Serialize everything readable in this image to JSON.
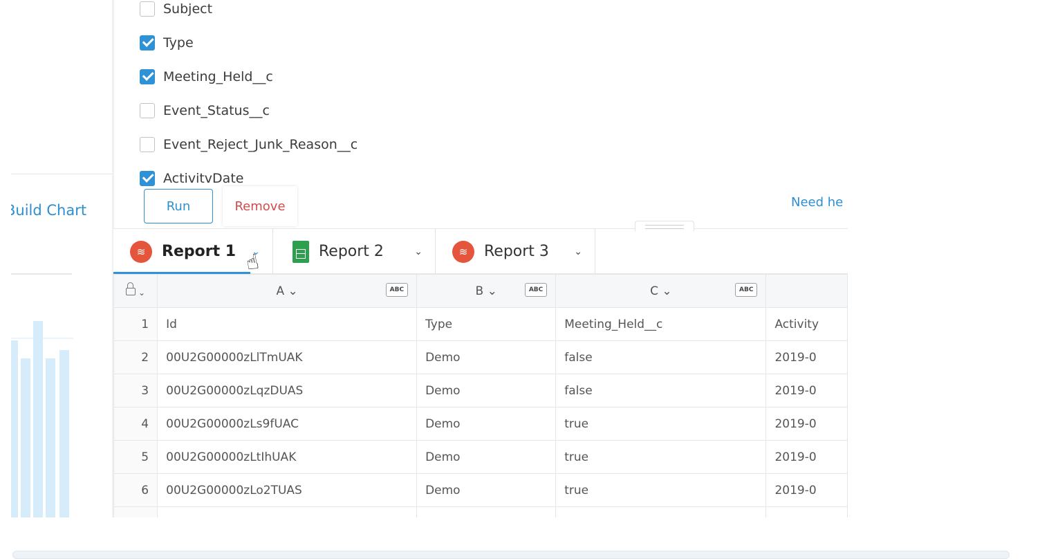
{
  "fields": [
    {
      "label": "Subject",
      "checked": false
    },
    {
      "label": "Type",
      "checked": true
    },
    {
      "label": "Meeting_Held__c",
      "checked": true
    },
    {
      "label": "Event_Status__c",
      "checked": false
    },
    {
      "label": "Event_Reject_Junk_Reason__c",
      "checked": false
    },
    {
      "label": "ActivitvDate",
      "checked": true
    }
  ],
  "actions": {
    "run": "Run",
    "remove": "Remove",
    "need_help": "Need he"
  },
  "side": {
    "build_chart": "Build Chart"
  },
  "tabs": [
    {
      "label": "Report 1",
      "icon": "salesforce-icon",
      "active": true
    },
    {
      "label": "Report 2",
      "icon": "sheets-icon",
      "active": false
    },
    {
      "label": "Report 3",
      "icon": "salesforce-icon",
      "active": false
    }
  ],
  "columns": [
    {
      "letter": "A ⌄",
      "type": "ABC"
    },
    {
      "letter": "B ⌄",
      "type": "ABC"
    },
    {
      "letter": "C ⌄",
      "type": "ABC"
    }
  ],
  "rows": [
    {
      "num": "1",
      "cells": [
        "Id",
        "Type",
        "Meeting_Held__c",
        "Activity"
      ]
    },
    {
      "num": "2",
      "cells": [
        "00U2G00000zLlTmUAK",
        "Demo",
        "false",
        "2019-0"
      ]
    },
    {
      "num": "3",
      "cells": [
        "00U2G00000zLqzDUAS",
        "Demo",
        "false",
        "2019-0"
      ]
    },
    {
      "num": "4",
      "cells": [
        "00U2G00000zLs9fUAC",
        "Demo",
        "true",
        "2019-0"
      ]
    },
    {
      "num": "5",
      "cells": [
        "00U2G00000zLtIhUAK",
        "Demo",
        "true",
        "2019-0"
      ]
    },
    {
      "num": "6",
      "cells": [
        "00U2G00000zLo2TUAS",
        "Demo",
        "true",
        "2019-0"
      ]
    }
  ],
  "colors": {
    "accent": "#2f91d6",
    "danger": "#d24a4a",
    "salesforce": "#e5553b",
    "sheets": "#2e9f4f"
  }
}
